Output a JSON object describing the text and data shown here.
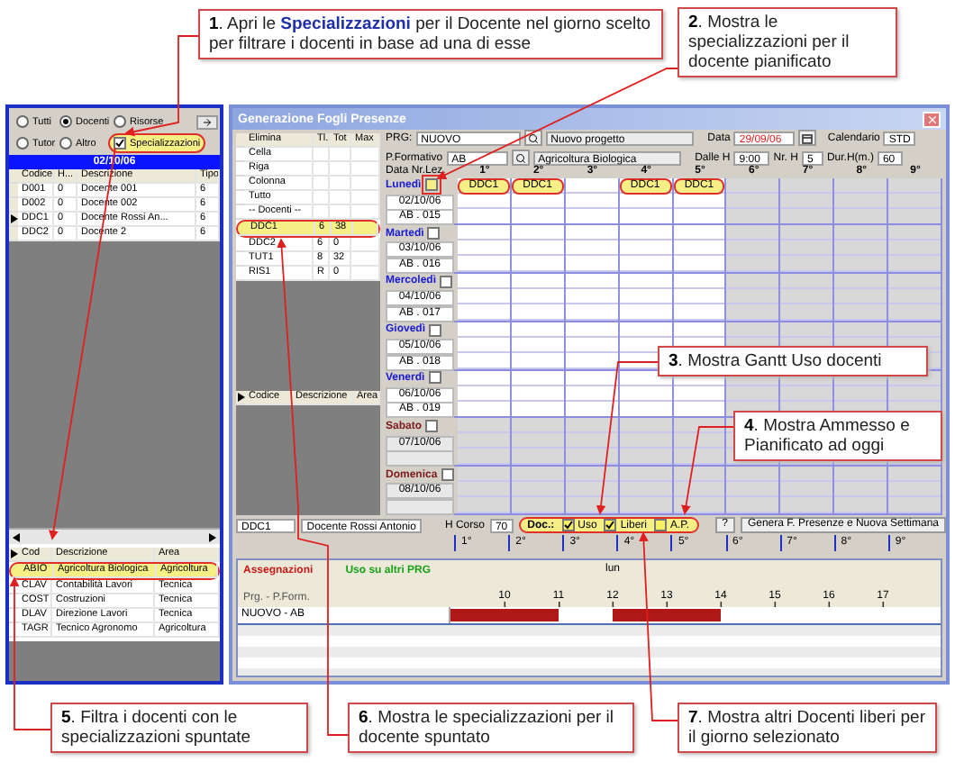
{
  "callouts": [
    {
      "text": "**1**.  Apri le **Specializzazioni** per il Docente nel giorno scelto per filtrare i docenti in base ad una di esse"
    },
    {
      "text": "**2**.  Mostra le specializzazioni per il docente pianificato"
    },
    {
      "text": "**3**.  Mostra Gantt Uso docenti"
    },
    {
      "text": "**4**.  Mostra Ammesso e Pianificato ad oggi"
    },
    {
      "text": "**5**.  Filtra i docenti con le specializzazioni spuntate"
    },
    {
      "text": "**6**.  Mostra le specializzazioni per il docente spuntato"
    },
    {
      "text": "**7**.  Mostra altri Docenti liberi per il giorno selezionato"
    }
  ],
  "filter_panel": {
    "option_rows": [
      [
        {
          "kind": "radio",
          "label": "Tutti",
          "selected": false,
          "highlighted": false
        },
        {
          "kind": "radio",
          "label": "Docenti",
          "selected": true,
          "highlighted": false
        },
        {
          "kind": "radio",
          "label": "Risorse",
          "selected": false,
          "highlighted": false
        }
      ],
      [
        {
          "kind": "radio",
          "label": "Tutor",
          "selected": false,
          "highlighted": false
        },
        {
          "kind": "radio",
          "label": "Altro",
          "selected": false,
          "highlighted": false
        },
        {
          "kind": "checkbox",
          "label": "Specializzazioni",
          "checked": true,
          "highlighted": true
        }
      ]
    ],
    "date": "02/10/06",
    "teachers": {
      "columns": [
        "Codice",
        "H...",
        "Descrizione",
        "Tipo"
      ],
      "rows": [
        {
          "cells": [
            "D001",
            "0",
            "Docente 001",
            "6"
          ],
          "current": false
        },
        {
          "cells": [
            "D002",
            "0",
            "Docente 002",
            "6"
          ],
          "current": false
        },
        {
          "cells": [
            "DDC1",
            "0",
            "Docente Rossi An...",
            "6"
          ],
          "current": true
        },
        {
          "cells": [
            "DDC2",
            "0",
            "Docente 2",
            "6"
          ],
          "current": false
        }
      ]
    },
    "specializations": {
      "columns": [
        "Cod",
        "Descrizione",
        "Area"
      ],
      "rows": [
        {
          "cells": [
            "ABIO",
            "Agricoltura Biologica",
            "Agricoltura"
          ],
          "highlighted": true
        },
        {
          "cells": [
            "CLAV",
            "Contabilità Lavori",
            "Tecnica"
          ],
          "highlighted": false
        },
        {
          "cells": [
            "COST",
            "Costruzioni",
            "Tecnica"
          ],
          "highlighted": false
        },
        {
          "cells": [
            "DLAV",
            "Direzione Lavori",
            "Tecnica"
          ],
          "highlighted": false
        },
        {
          "cells": [
            "TAGR",
            "Tecnico Agronomo",
            "Agricoltura"
          ],
          "highlighted": false
        }
      ]
    }
  },
  "window": {
    "title": "Generazione Fogli Presenze",
    "resources": {
      "columns": [
        "Elimina",
        "Tl.",
        "Tot",
        "Max"
      ],
      "rows": [
        {
          "name": "Cella",
          "highlighted": false
        },
        {
          "name": "Riga",
          "highlighted": false
        },
        {
          "name": "Colonna",
          "highlighted": false
        },
        {
          "name": "Tutto",
          "highlighted": false
        },
        {
          "name": "-- Docenti --",
          "highlighted": false
        },
        {
          "name": "DDC1",
          "tl": "6",
          "tot": "38",
          "highlighted": true
        },
        {
          "name": "DDC2",
          "tl": "6",
          "tot": "0",
          "highlighted": false
        },
        {
          "name": "TUT1",
          "tl": "8",
          "tot": "32",
          "highlighted": false
        },
        {
          "name": "RIS1",
          "tl": "R",
          "tot": "0",
          "highlighted": false
        }
      ]
    },
    "specializations_columns": [
      "Codice",
      "Descrizione",
      "Area"
    ],
    "form": {
      "prg_label": "PRG:",
      "prg": "NUOVO",
      "project": "Nuovo progetto",
      "pf_label": "P.Formativo",
      "pf": "AB",
      "pf_name": "Agricoltura Biologica",
      "date_label": "Data",
      "date": "29/09/06",
      "calendar_label": "Calendario",
      "calendar": "STD",
      "from_label": "Dalle H",
      "from": "9:00",
      "hours_label": "Nr. H",
      "hours": "5",
      "duration_label": "Dur.H(m.)",
      "duration": "60"
    },
    "grid_header": "Data Nr.Lez.",
    "slots": [
      "1°",
      "2°",
      "3°",
      "4°",
      "5°",
      "6°",
      "7°",
      "8°",
      "9°"
    ],
    "days": [
      {
        "name": "Lunedì",
        "date": "02/10/06",
        "lesson": "AB . 015",
        "weekend": false,
        "checked": false,
        "highlighted": true,
        "cells": [
          {
            "code": "DDC1"
          },
          {
            "code": "DDC1"
          },
          {},
          {
            "code": "DDC1"
          },
          {
            "code": "DDC1"
          }
        ]
      },
      {
        "name": "Martedì",
        "date": "03/10/06",
        "lesson": "AB . 016",
        "weekend": false,
        "checked": false,
        "highlighted": false
      },
      {
        "name": "Mercoledì",
        "date": "04/10/06",
        "lesson": "AB . 017",
        "weekend": false,
        "checked": false,
        "highlighted": false
      },
      {
        "name": "Giovedì",
        "date": "05/10/06",
        "lesson": "AB . 018",
        "weekend": false,
        "checked": false,
        "highlighted": false
      },
      {
        "name": "Venerdì",
        "date": "06/10/06",
        "lesson": "AB . 019",
        "weekend": false,
        "checked": false,
        "highlighted": false
      },
      {
        "name": "Sabato",
        "date": "07/10/06",
        "weekend": true,
        "checked": false,
        "highlighted": false
      },
      {
        "name": "Domenica",
        "date": "08/10/06",
        "weekend": true,
        "checked": false,
        "highlighted": false
      }
    ],
    "footer": {
      "code": "DDC1",
      "teacher": "Docente Rossi Antonio",
      "course_hours_label": "H Corso",
      "course_hours": "70",
      "doc_label": "Doc.:",
      "toggles": [
        {
          "label": "Uso",
          "checked": true
        },
        {
          "label": "Liberi",
          "checked": true
        },
        {
          "label": "A.P.",
          "checked": false
        }
      ],
      "help": "?",
      "generate": "Genera F. Presenze e Nuova Settimana"
    },
    "ruler": [
      "1°",
      "2°",
      "3°",
      "4°",
      "5°",
      "6°",
      "7°",
      "8°",
      "9°"
    ],
    "gantt": {
      "tabs": [
        {
          "label": "Assegnazioni",
          "color": "#c81818"
        },
        {
          "label": "Uso su altri PRG",
          "color": "#18a018"
        }
      ],
      "header": "Prg. - P.Form.",
      "day": "lun",
      "hours": [
        "10",
        "11",
        "12",
        "13",
        "14",
        "15",
        "16",
        "17"
      ],
      "rows": [
        {
          "label": "NUOVO - AB"
        }
      ]
    }
  }
}
